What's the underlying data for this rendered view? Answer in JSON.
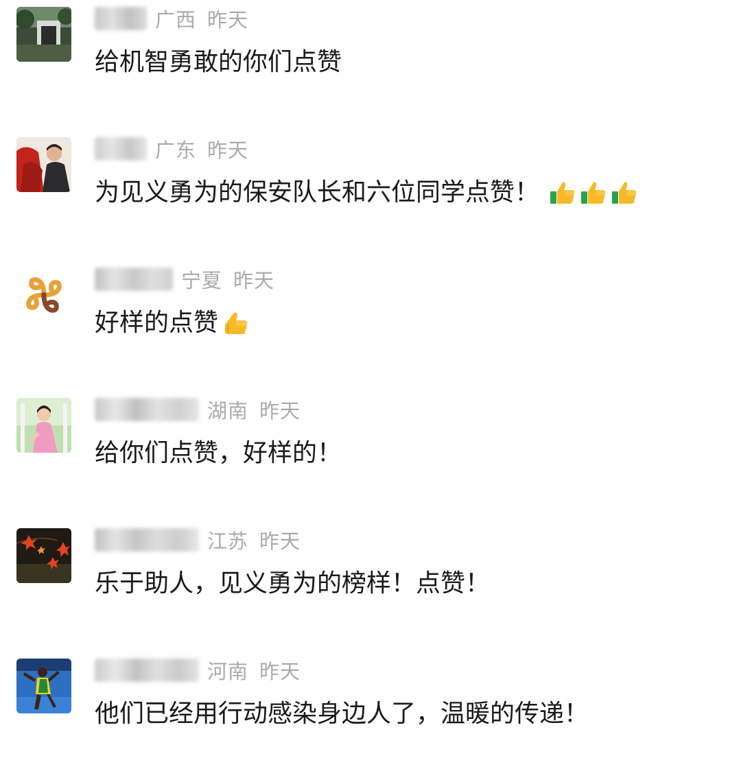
{
  "comments": [
    {
      "avatar": "photo-gate-avatar",
      "region": "广西",
      "time": "昨天",
      "text": "给机智勇敢的你们点赞",
      "emoji_count": 0,
      "emoji": ""
    },
    {
      "avatar": "photo-couple-avatar",
      "region": "广东",
      "time": "昨天",
      "text": "为见义勇为的保安队长和六位同学点赞！",
      "emoji_count": 3,
      "emoji": "thumbs-up-icon"
    },
    {
      "avatar": "swirl-logo-avatar",
      "region": "宁夏",
      "time": "昨天",
      "text": "好样的点赞",
      "emoji_count": 1,
      "emoji": "thumbs-up-icon"
    },
    {
      "avatar": "photo-girl-avatar",
      "region": "湖南",
      "time": "昨天",
      "text": "给你们点赞，好样的！",
      "emoji_count": 0,
      "emoji": ""
    },
    {
      "avatar": "maple-leaves-avatar",
      "region": "江苏",
      "time": "昨天",
      "text": "乐于助人，见义勇为的榜样！点赞！",
      "emoji_count": 0,
      "emoji": ""
    },
    {
      "avatar": "photo-athlete-avatar",
      "region": "河南",
      "time": "昨天",
      "text": "他们已经用行动感染身边人了，温暖的传递！",
      "emoji_count": 0,
      "emoji": ""
    }
  ]
}
